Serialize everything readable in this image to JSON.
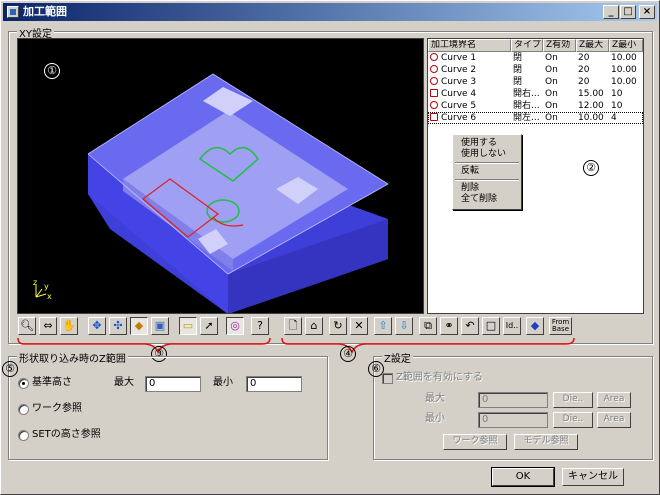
{
  "window": {
    "title": "加工範囲",
    "min": "_",
    "max": "□",
    "close": "×"
  },
  "xy_group": {
    "title": "XY設定"
  },
  "markers": {
    "m1": "①",
    "m2": "②",
    "m3": "③",
    "m4": "④",
    "m5": "⑤",
    "m6": "⑥"
  },
  "list": {
    "columns": [
      "加工境界名",
      "タイプ",
      "Z有効",
      "Z最大",
      "Z最小"
    ],
    "rows": [
      {
        "icon": "closed-curve-icon",
        "name": "Curve 1",
        "type": "閉",
        "z": "On",
        "zmax": "20",
        "zmin": "10.00"
      },
      {
        "icon": "closed-curve-icon",
        "name": "Curve 2",
        "type": "閉",
        "z": "On",
        "zmax": "20",
        "zmin": "10.00"
      },
      {
        "icon": "closed-curve-icon",
        "name": "Curve 3",
        "type": "閉",
        "z": "On",
        "zmax": "20",
        "zmin": "10.00"
      },
      {
        "icon": "open-curve-icon",
        "name": "Curve 4",
        "type": "開右...",
        "z": "On",
        "zmax": "15.00",
        "zmin": "10"
      },
      {
        "icon": "closed-curve-icon",
        "name": "Curve 5",
        "type": "開右...",
        "z": "On",
        "zmax": "12.00",
        "zmin": "10"
      },
      {
        "icon": "open-curve-icon",
        "name": "Curve 6",
        "type": "開左...",
        "z": "On",
        "zmax": "10.00",
        "zmin": "4"
      }
    ]
  },
  "context_menu": {
    "use": "使用する",
    "unuse": "使用しない",
    "reverse": "反転",
    "delete": "削除",
    "delete_all": "全て削除"
  },
  "toolbar": {
    "from_base_1": "From",
    "from_base_2": "Base",
    "id": "Id.."
  },
  "z_range_group": {
    "title": "形状取り込み時のZ範囲",
    "opt_base": "基準高さ",
    "opt_work": "ワーク参照",
    "opt_set": "SETの高さ参照",
    "max_label": "最大",
    "max_value": "0",
    "min_label": "最小",
    "min_value": "0"
  },
  "z_group": {
    "title": "Z設定",
    "enable_label": "Z範囲を有効にする",
    "max_label": "最大",
    "max_value": "0",
    "min_label": "最小",
    "min_value": "0",
    "die": "Die..",
    "area": "Area",
    "work_ref": "ワーク参照",
    "model_ref": "モデル参照"
  },
  "buttons": {
    "ok": "OK",
    "cancel": "キャンセル"
  },
  "axis": {
    "x": "x",
    "y": "y",
    "z": "z"
  }
}
